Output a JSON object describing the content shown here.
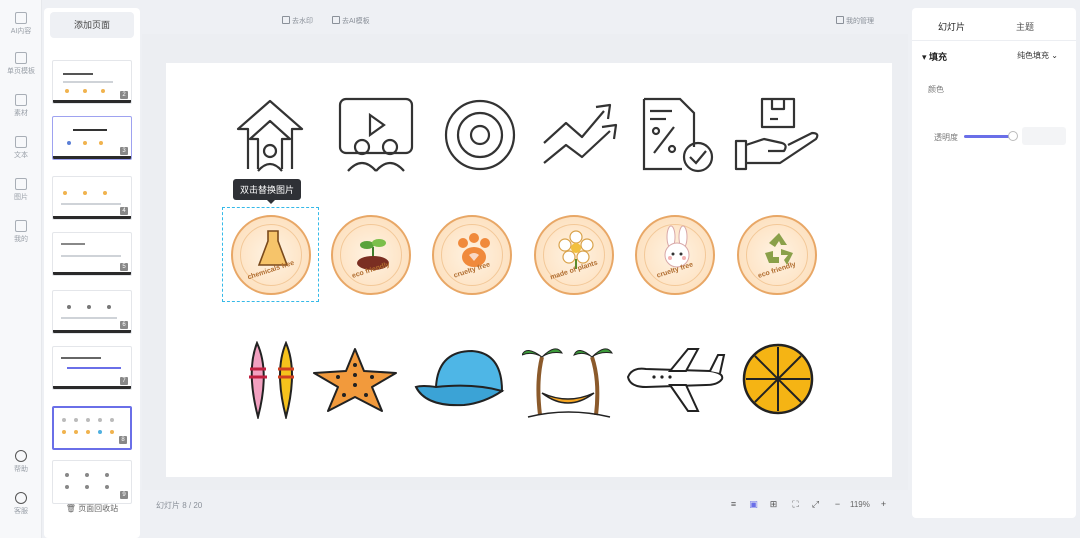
{
  "rail": {
    "items": [
      {
        "label": "AI内容",
        "icon": "ai-icon"
      },
      {
        "label": "单页模板",
        "icon": "template-icon"
      },
      {
        "label": "素材",
        "icon": "material-icon"
      },
      {
        "label": "文本",
        "icon": "text-icon"
      },
      {
        "label": "图片",
        "icon": "image-icon"
      },
      {
        "label": "我的",
        "icon": "mine-icon"
      },
      {
        "label": "帮助",
        "icon": "help-icon"
      },
      {
        "label": "客服",
        "icon": "service-icon"
      }
    ]
  },
  "slides": {
    "add_label": "添加页面",
    "numbers": [
      "2",
      "3",
      "4",
      "5",
      "6",
      "7",
      "8",
      "9"
    ],
    "footer": "页面回收站"
  },
  "topbar": {
    "left_link": "去水印",
    "right_link": "去AI模板",
    "manage": "我的管理"
  },
  "canvas": {
    "tooltip": "双击替换图片",
    "badge_captions": [
      "chemicals free",
      "eco friendly",
      "cruelty free",
      "made of plants",
      "cruelty free",
      "eco friendly"
    ]
  },
  "bottombar": {
    "page_indicator": "幻灯片 8 / 20",
    "zoom": "119%"
  },
  "right_panel": {
    "tabs": [
      "幻灯片",
      "主题"
    ],
    "fill_heading": "填充",
    "fill_mode": "纯色填充",
    "color_label": "颜色",
    "opacity_label": "透明度",
    "opacity_value": ""
  },
  "colors": {
    "accent": "#6a6fe8",
    "badge_border": "#e8a766",
    "selection": "#35b9e8"
  }
}
